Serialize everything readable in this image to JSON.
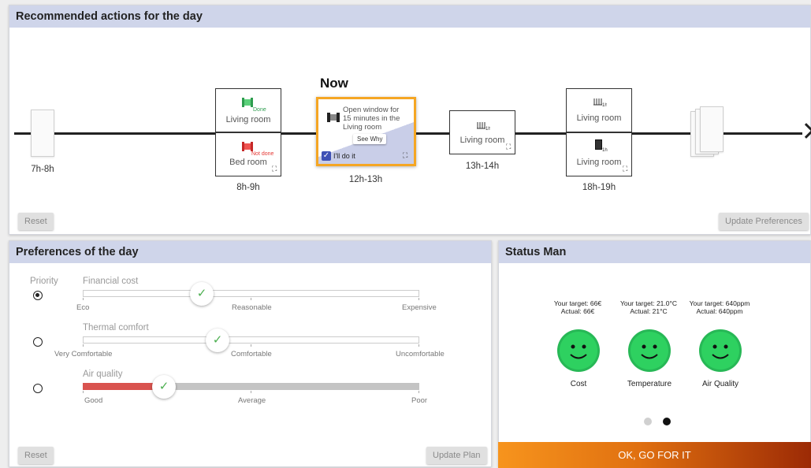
{
  "top": {
    "title": "Recommended actions for the day",
    "now_label": "Now",
    "slots": [
      {
        "time": "7h-8h"
      },
      {
        "time": "8h-9h",
        "rooms": [
          {
            "room": "Living room",
            "status": "Done",
            "status_color": "#2e9d4f"
          },
          {
            "room": "Bed room",
            "status": "Not done",
            "status_color": "#e53935"
          }
        ]
      },
      {
        "time": "12h-13h",
        "text": "Open window for 15 minutes in the Living room",
        "see_why": "See Why",
        "ill_do_it": "I'll do it",
        "checked": true
      },
      {
        "time": "13h-14h",
        "rooms": [
          {
            "room": "Living room",
            "duration": "1h"
          }
        ]
      },
      {
        "time": "18h-19h",
        "rooms": [
          {
            "room": "Living room",
            "duration": "1h"
          },
          {
            "room": "Living room",
            "duration": "1h"
          }
        ]
      }
    ],
    "reset_label": "Reset",
    "update_prefs_label": "Update Preferences"
  },
  "prefs": {
    "title": "Preferences of the day",
    "priority_label": "Priority",
    "sliders": [
      {
        "label": "Financial cost",
        "ticks": [
          "Eco",
          "Reasonable",
          "Expensive"
        ],
        "value": 0.34,
        "selected": true
      },
      {
        "label": "Thermal comfort",
        "ticks": [
          "Very Comfortable",
          "Comfortable",
          "Uncomfortable"
        ],
        "value": 0.4,
        "selected": false
      },
      {
        "label": "Air quality",
        "ticks": [
          "Good",
          "Average",
          "Poor"
        ],
        "value": 0.24,
        "selected": false,
        "fill_color": "#d9534f",
        "track_color": "#c4c4c4"
      }
    ],
    "reset_label": "Reset",
    "update_plan_label": "Update Plan"
  },
  "status": {
    "title": "Status Man",
    "metrics": [
      {
        "target": "Your target: 66€",
        "actual": "Actual: 66€",
        "name": "Cost"
      },
      {
        "target": "Your target: 21.0°C",
        "actual": "Actual: 21°C",
        "name": "Temperature"
      },
      {
        "target": "Your target: 640ppm",
        "actual": "Actual: 640ppm",
        "name": "Air Quality"
      }
    ],
    "page": 2,
    "page_count": 2,
    "go_label": "OK, GO FOR IT"
  },
  "colors": {
    "accent_orange": "#f5a623",
    "header_bg": "#cfd5ea",
    "smiley_green": "#2ed160"
  }
}
